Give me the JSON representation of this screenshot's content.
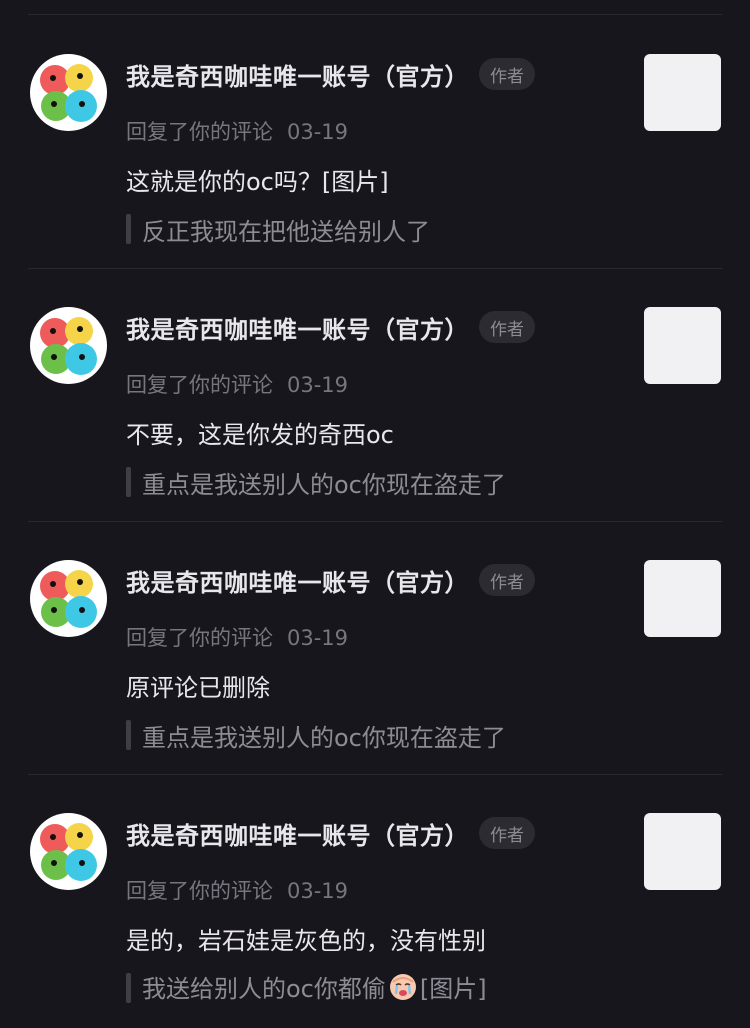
{
  "comments": [
    {
      "user_name": "我是奇西咖哇唯一账号（官方）",
      "badge": "作者",
      "action": "回复了你的评论",
      "date": "03-19",
      "reply": "这就是你的oc吗？[图片]",
      "quote": "反正我现在把他送给别人了"
    },
    {
      "user_name": "我是奇西咖哇唯一账号（官方）",
      "badge": "作者",
      "action": "回复了你的评论",
      "date": "03-19",
      "reply": "不要，这是你发的奇西oc",
      "quote": "重点是我送别人的oc你现在盗走了"
    },
    {
      "user_name": "我是奇西咖哇唯一账号（官方）",
      "badge": "作者",
      "action": "回复了你的评论",
      "date": "03-19",
      "reply": "原评论已删除",
      "quote": "重点是我送别人的oc你现在盗走了"
    },
    {
      "user_name": "我是奇西咖哇唯一账号（官方）",
      "badge": "作者",
      "action": "回复了你的评论",
      "date": "03-19",
      "reply": "是的，岩石娃是灰色的，没有性别",
      "quote_before": "我送给别人的oc你都偷",
      "quote_emoji": "crying-face-icon",
      "quote_after": "[图片]"
    }
  ]
}
